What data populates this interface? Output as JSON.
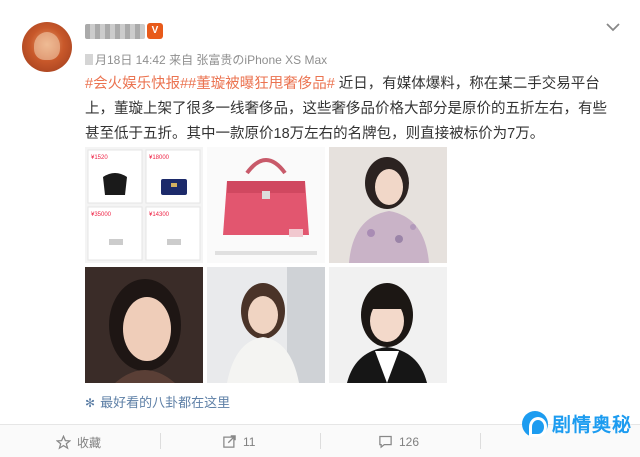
{
  "post": {
    "username": "",
    "vip_badge": "V",
    "meta_date": "月18日 14:42",
    "meta_from": "来自",
    "meta_device": "张富贵のiPhone XS Max",
    "topic1": "#会火娱乐快报#",
    "topic2": "#董璇被曝狂甩奢侈品#",
    "body": " 近日，有媒体爆料，称在某二手交易平台上，董璇上架了很多一线奢侈品，这些奢侈品价格大部分是原价的五折左右，有些甚至低于五折。其中一款原价18万左右的名牌包，则直接被标价为7万。",
    "caption": "最好看的八卦都在这里"
  },
  "screenshot_prices": [
    "¥1520",
    "¥18000",
    "¥35000",
    "¥14300"
  ],
  "actions": {
    "favorite_label": "收藏",
    "repost_count": "11",
    "comment_count": "126"
  },
  "watermark": {
    "text": "剧情奥秘"
  },
  "icons": [
    "chevron-down-icon",
    "star-icon",
    "repost-icon",
    "comment-icon",
    "like-icon",
    "snowflake-icon"
  ]
}
